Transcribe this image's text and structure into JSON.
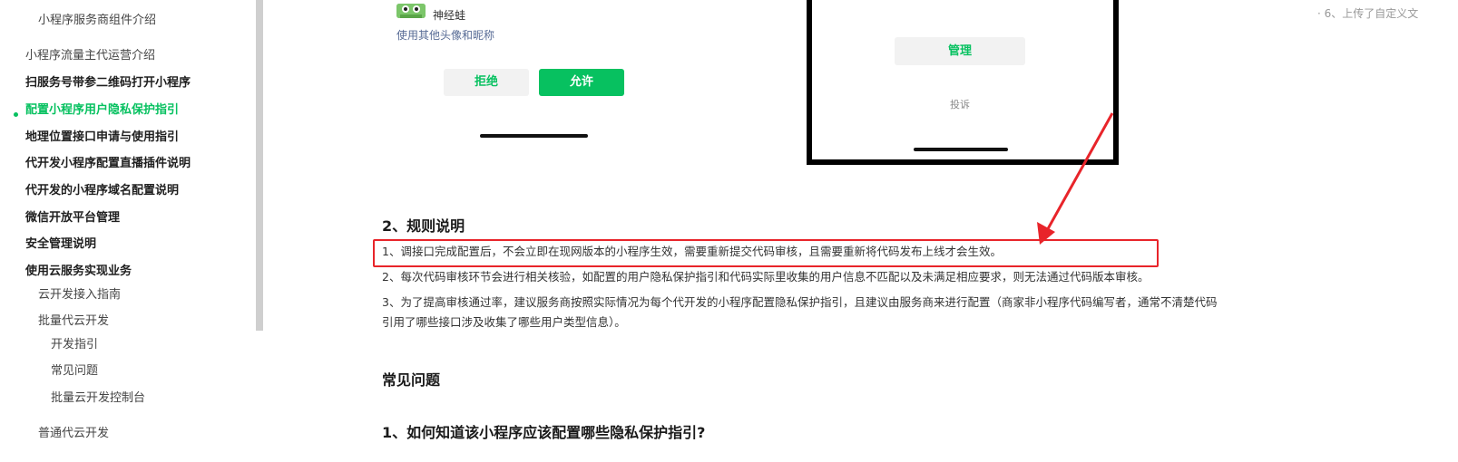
{
  "sidebar": {
    "items": [
      {
        "label": "小程序服务商组件介绍",
        "level": 2,
        "style": "normal"
      },
      {
        "label": "小程序流量主代运营介绍",
        "level": 1,
        "style": "normal"
      },
      {
        "label": "扫服务号带参二维码打开小程序",
        "level": 1,
        "style": "bold"
      },
      {
        "label": "配置小程序用户隐私保护指引",
        "level": 1,
        "style": "active"
      },
      {
        "label": "地理位置接口申请与使用指引",
        "level": 1,
        "style": "bold"
      },
      {
        "label": "代开发小程序配置直播插件说明",
        "level": 1,
        "style": "bold"
      },
      {
        "label": "代开发的小程序域名配置说明",
        "level": 1,
        "style": "bold"
      },
      {
        "label": "微信开放平台管理",
        "level": 1,
        "style": "bold"
      },
      {
        "label": "安全管理说明",
        "level": 1,
        "style": "bold"
      },
      {
        "label": "使用云服务实现业务",
        "level": 1,
        "style": "bold"
      },
      {
        "label": "云开发接入指南",
        "level": 2,
        "style": "normal"
      },
      {
        "label": "批量代云开发",
        "level": 2,
        "style": "normal"
      },
      {
        "label": "开发指引",
        "level": 3,
        "style": "normal"
      },
      {
        "label": "常见问题",
        "level": 3,
        "style": "normal"
      },
      {
        "label": "批量云开发控制台",
        "level": 3,
        "style": "normal"
      },
      {
        "label": "普通代云开发",
        "level": 2,
        "style": "normal"
      }
    ]
  },
  "phone_left": {
    "avatar_name": "神经蛙",
    "other_link": "使用其他头像和昵称",
    "reject_label": "拒绝",
    "allow_label": "允许"
  },
  "phone_right": {
    "manage_label": "管理",
    "complain_label": "投诉"
  },
  "side_note": "· 6、上传了自定义文",
  "content": {
    "rules_heading": "2、规则说明",
    "rules": [
      "1、调接口完成配置后，不会立即在现网版本的小程序生效，需要重新提交代码审核，且需要重新将代码发布上线才会生效。",
      "2、每次代码审核环节会进行相关核验，如配置的用户隐私保护指引和代码实际里收集的用户信息不匹配以及未满足相应要求，则无法通过代码版本审核。",
      "3、为了提高审核通过率，建议服务商按照实际情况为每个代开发的小程序配置隐私保护指引，且建议由服务商来进行配置（商家非小程序代码编写者，通常不清楚代码引用了哪些接口涉及收集了哪些用户类型信息）。"
    ],
    "faq_heading": "常见问题",
    "faq_q1": "1、如何知道该小程序应该配置哪些隐私保护指引?"
  },
  "colors": {
    "accent": "#07c160",
    "highlight": "#e8242a",
    "link": "#576b95"
  }
}
